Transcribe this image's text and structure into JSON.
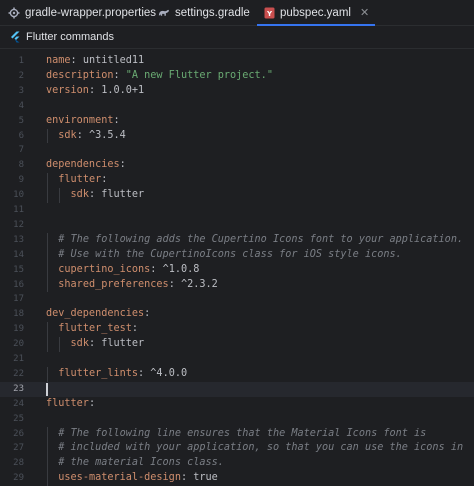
{
  "tabs": [
    {
      "label": "gradle-wrapper.properties",
      "icon": "gear-icon",
      "active": false
    },
    {
      "label": "settings.gradle",
      "icon": "gradle-icon",
      "active": false
    },
    {
      "label": "pubspec.yaml",
      "icon": "yaml-file-icon",
      "active": true,
      "close": "✕"
    }
  ],
  "toolbar": {
    "label": "Flutter commands",
    "icon": "flutter-icon"
  },
  "editor": {
    "current_line": 23,
    "lines": [
      {
        "n": "1",
        "key": "name",
        "sep": ": ",
        "val": "untitled11",
        "vtype": "p"
      },
      {
        "n": "2",
        "key": "description",
        "sep": ": ",
        "val": "\"A new Flutter project.\"",
        "vtype": "s"
      },
      {
        "n": "3",
        "key": "version",
        "sep": ": ",
        "val": "1.0.0+1",
        "vtype": "p"
      },
      {
        "n": "4"
      },
      {
        "n": "5",
        "key": "environment",
        "sep": ":"
      },
      {
        "n": "6",
        "indent": "  ",
        "key": "sdk",
        "sep": ": ",
        "val": "^3.5.4",
        "vtype": "p"
      },
      {
        "n": "7"
      },
      {
        "n": "8",
        "key": "dependencies",
        "sep": ":"
      },
      {
        "n": "9",
        "indent": "  ",
        "key": "flutter",
        "sep": ":"
      },
      {
        "n": "10",
        "indent": "    ",
        "key": "sdk",
        "sep": ": ",
        "val": "flutter",
        "vtype": "p"
      },
      {
        "n": "11"
      },
      {
        "n": "12"
      },
      {
        "n": "13",
        "indent": "  ",
        "comment": "# The following adds the Cupertino Icons font to your application."
      },
      {
        "n": "14",
        "indent": "  ",
        "comment": "# Use with the CupertinoIcons class for iOS style icons."
      },
      {
        "n": "15",
        "indent": "  ",
        "key": "cupertino_icons",
        "sep": ": ",
        "val": "^1.0.8",
        "vtype": "p"
      },
      {
        "n": "16",
        "indent": "  ",
        "key": "shared_preferences",
        "sep": ": ",
        "val": "^2.3.2",
        "vtype": "p"
      },
      {
        "n": "17"
      },
      {
        "n": "18",
        "key": "dev_dependencies",
        "sep": ":"
      },
      {
        "n": "19",
        "indent": "  ",
        "key": "flutter_test",
        "sep": ":"
      },
      {
        "n": "20",
        "indent": "    ",
        "key": "sdk",
        "sep": ": ",
        "val": "flutter",
        "vtype": "p"
      },
      {
        "n": "21"
      },
      {
        "n": "22",
        "indent": "  ",
        "key": "flutter_lints",
        "sep": ": ",
        "val": "^4.0.0",
        "vtype": "p"
      },
      {
        "n": "23"
      },
      {
        "n": "24",
        "key": "flutter",
        "sep": ":"
      },
      {
        "n": "25"
      },
      {
        "n": "26",
        "indent": "  ",
        "comment": "# The following line ensures that the Material Icons font is"
      },
      {
        "n": "27",
        "indent": "  ",
        "comment": "# included with your application, so that you can use the icons in"
      },
      {
        "n": "28",
        "indent": "  ",
        "comment": "# the material Icons class."
      },
      {
        "n": "29",
        "indent": "  ",
        "key": "uses-material-design",
        "sep": ": ",
        "val": "true",
        "vtype": "p"
      }
    ]
  }
}
